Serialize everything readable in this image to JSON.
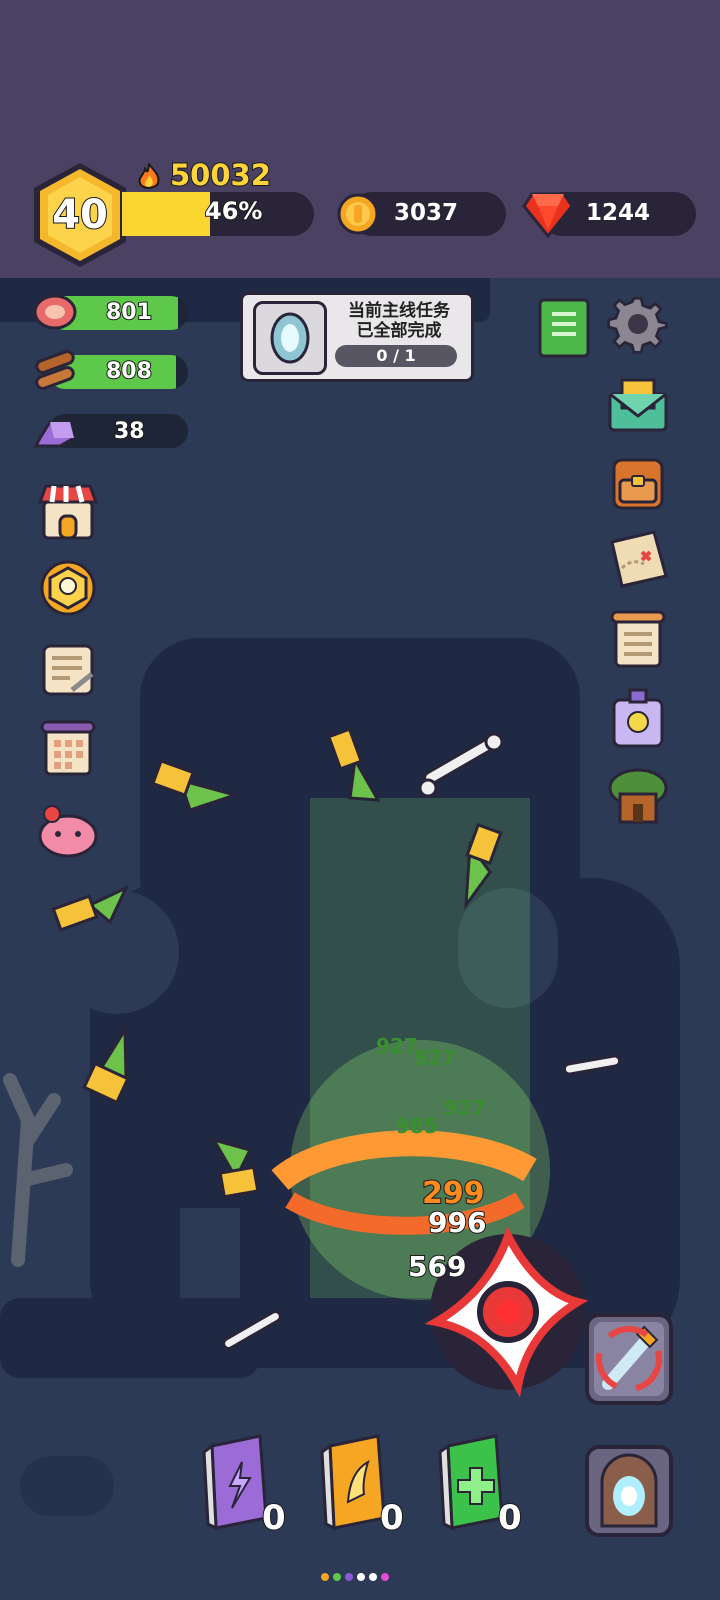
{
  "player": {
    "level": "40",
    "power": "50032",
    "xp_percent_label": "46%",
    "xp_fraction": 0.46
  },
  "currencies": {
    "gold": "3037",
    "gems": "1244"
  },
  "resources": {
    "meat": "801",
    "wood": "808",
    "crystal": "38"
  },
  "quest": {
    "title_line1": "当前主线任务",
    "title_line2": "已全部完成",
    "progress": "0 / 1"
  },
  "damage_numbers": {
    "heal1": "927",
    "heal2": "927",
    "heal3": "927",
    "heal4": "985",
    "crit": "299",
    "hit1": "996",
    "hit2": "569"
  },
  "skills": {
    "lightning_book_count": "0",
    "wing_book_count": "0",
    "heal_book_count": "0"
  },
  "colors": {
    "top_bg": "#4b4162",
    "arena_bg": "#2c3a55",
    "accent_yellow": "#fbd631",
    "heal_green": "#5ec84a"
  }
}
